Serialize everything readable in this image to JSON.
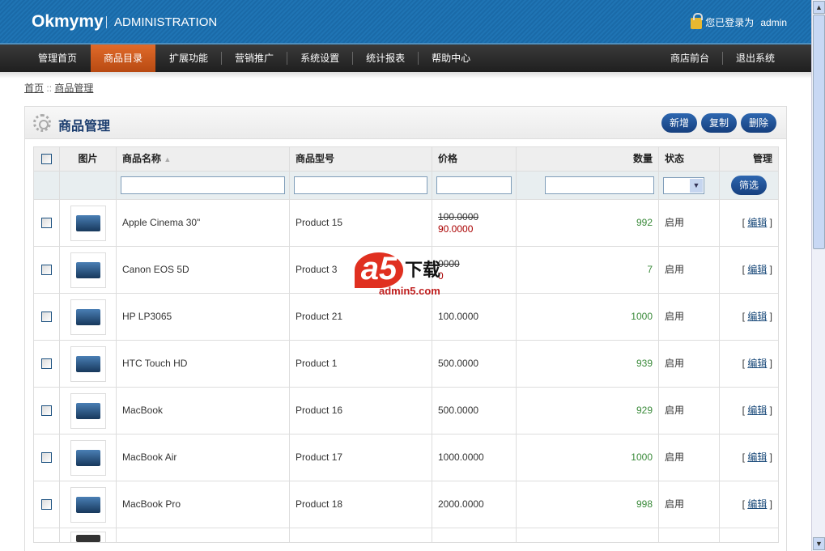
{
  "header": {
    "logo": "Okmymy",
    "subtitle": "ADMINISTRATION",
    "login_text": "您已登录为",
    "user": "admin"
  },
  "nav": {
    "left": [
      "管理首页",
      "商品目录",
      "扩展功能",
      "营销推广",
      "系统设置",
      "统计报表",
      "帮助中心"
    ],
    "active": 1,
    "right": [
      "商店前台",
      "退出系统"
    ]
  },
  "breadcrumb": {
    "home": "首页",
    "sep": "::",
    "current": "商品管理"
  },
  "panel": {
    "title": "商品管理",
    "buttons": {
      "add": "新增",
      "copy": "复制",
      "delete": "删除"
    }
  },
  "table": {
    "headers": {
      "image": "图片",
      "name": "商品名称",
      "model": "商品型号",
      "price": "价格",
      "quantity": "数量",
      "status": "状态",
      "action": "管理"
    },
    "sort_indicator": "▲",
    "filter_button": "筛选",
    "rows": [
      {
        "name": "Apple Cinema 30\"",
        "model": "Product 15",
        "price": "100.0000",
        "special": "90.0000",
        "quantity": "992",
        "status": "启用",
        "edit": "编辑"
      },
      {
        "name": "Canon EOS 5D",
        "model": "Product 3",
        "price": "0000",
        "special": "0",
        "quantity": "7",
        "status": "启用",
        "edit": "编辑"
      },
      {
        "name": "HP LP3065",
        "model": "Product 21",
        "price": "100.0000",
        "quantity": "1000",
        "status": "启用",
        "edit": "编辑"
      },
      {
        "name": "HTC Touch HD",
        "model": "Product 1",
        "price": "500.0000",
        "quantity": "939",
        "status": "启用",
        "edit": "编辑"
      },
      {
        "name": "MacBook",
        "model": "Product 16",
        "price": "500.0000",
        "quantity": "929",
        "status": "启用",
        "edit": "编辑"
      },
      {
        "name": "MacBook Air",
        "model": "Product 17",
        "price": "1000.0000",
        "quantity": "1000",
        "status": "启用",
        "edit": "编辑"
      },
      {
        "name": "MacBook Pro",
        "model": "Product 18",
        "price": "2000.0000",
        "quantity": "998",
        "status": "启用",
        "edit": "编辑"
      }
    ]
  },
  "watermark": {
    "brand": "a5",
    "text": "下载",
    "site": "admin5.com"
  }
}
